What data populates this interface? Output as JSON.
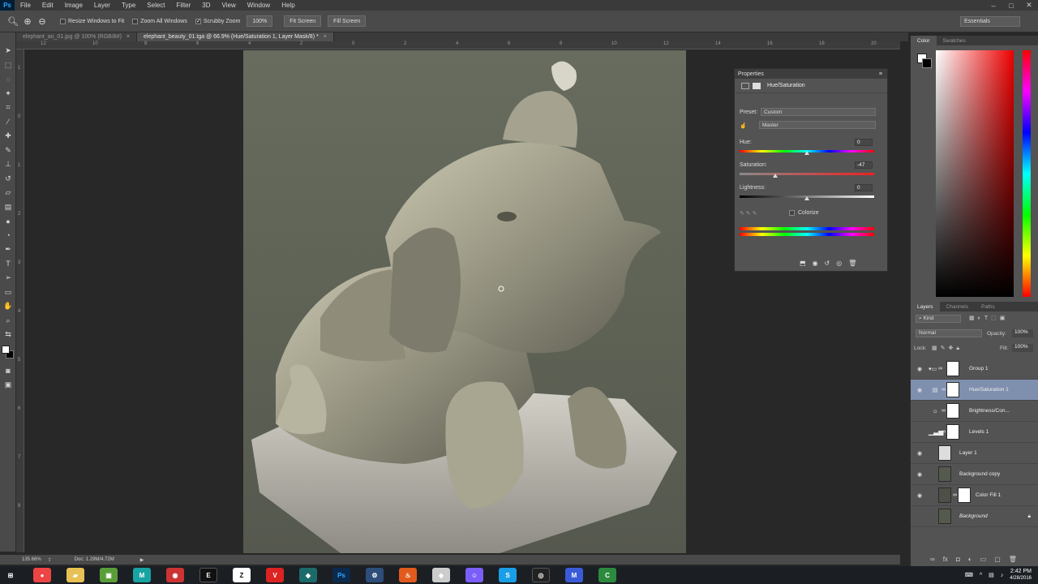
{
  "menubar": {
    "logo": "Ps",
    "items": [
      "File",
      "Edit",
      "Image",
      "Layer",
      "Type",
      "Select",
      "Filter",
      "3D",
      "View",
      "Window",
      "Help"
    ]
  },
  "options_bar": {
    "resize_windows": "Resize Windows to Fit",
    "zoom_all": "Zoom All Windows",
    "scrubby_zoom": "Scrubby Zoom",
    "zoom_100": "100%",
    "fit_screen": "Fit Screen",
    "fill_screen": "Fill Screen",
    "workspace": "Essentials"
  },
  "tabs": [
    {
      "label": "elephant_ao_01.jpg @ 100% (RGB/8#)"
    },
    {
      "label": "elephant_beauty_01.tga @ 66.9% (Hue/Saturation 1, Layer Mask/8) *"
    }
  ],
  "ruler_top": [
    "12",
    "10",
    "8",
    "6",
    "4",
    "2",
    "0",
    "2",
    "4",
    "6",
    "8",
    "10",
    "12",
    "14",
    "16",
    "18",
    "20"
  ],
  "ruler_left": [
    "1",
    "0",
    "1",
    "2",
    "3",
    "4",
    "5",
    "6",
    "7",
    "8",
    "9"
  ],
  "statusbar": {
    "zoom": "135.66%",
    "doc": "Doc: 1.29M/4.72M"
  },
  "properties": {
    "panel_title": "Properties",
    "adjustment": "Hue/Saturation",
    "preset_label": "Preset:",
    "preset_value": "Custom",
    "channel_value": "Master",
    "hue_label": "Hue:",
    "hue_value": "0",
    "saturation_label": "Saturation:",
    "saturation_value": "-47",
    "lightness_label": "Lightness:",
    "lightness_value": "0",
    "colorize_label": "Colorize"
  },
  "dock": {
    "color_tab": "Color",
    "swatches_tab": "Swatches",
    "layers_tab": "Layers",
    "channels_tab": "Channels",
    "paths_tab": "Paths",
    "filter_kind": "Kind",
    "blend_mode": "Normal",
    "opacity_label": "Opacity:",
    "opacity_value": "100%",
    "lock_label": "Lock:",
    "fill_label": "Fill:",
    "fill_value": "100%",
    "layers": [
      {
        "name": "Group 1"
      },
      {
        "name": "Hue/Saturation 1"
      },
      {
        "name": "Brightness/Con..."
      },
      {
        "name": "Levels 1"
      },
      {
        "name": "Layer 1"
      },
      {
        "name": "Background copy"
      },
      {
        "name": "Color Fill 1"
      },
      {
        "name": "Background"
      }
    ]
  },
  "taskbar": {
    "time": "2:42 PM",
    "date": "4/28/2016"
  }
}
